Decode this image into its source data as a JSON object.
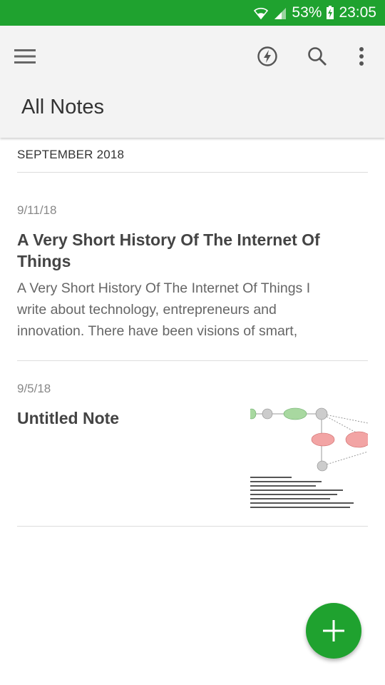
{
  "status_bar": {
    "battery": "53%",
    "time": "23:05",
    "icons": [
      "wifi-icon",
      "signal-icon",
      "battery-charging-icon"
    ]
  },
  "app_bar": {
    "title": "All Notes",
    "icons": [
      "menu-icon",
      "shortcut-lightning-icon",
      "search-icon",
      "more-vert-icon"
    ]
  },
  "section": {
    "header": "SEPTEMBER 2018"
  },
  "notes": [
    {
      "date": "9/11/18",
      "title": "A Very Short History Of The Internet Of Things",
      "snippet": "A Very Short History Of The Internet Of Things I write about technology, entrepreneurs and innovation. There have been visions of smart,"
    },
    {
      "date": "9/5/18",
      "title": "Untitled Note",
      "thumbnail": "diagram-thumbnail"
    }
  ],
  "fab": {
    "icon": "plus-icon"
  },
  "colors": {
    "brand_green": "#1fa22f",
    "app_bar_bg": "#f3f3f3"
  }
}
